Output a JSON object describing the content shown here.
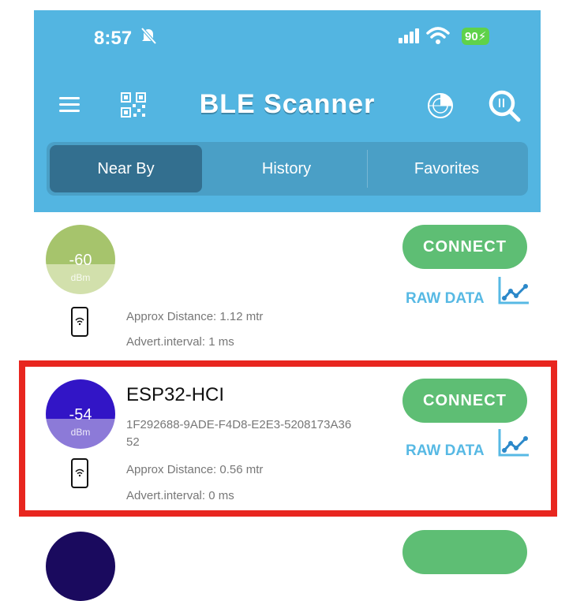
{
  "status_bar": {
    "time": "8:57",
    "battery": "90",
    "bell_icon": "bell-muted-icon",
    "signal_icon": "cellular-signal-icon",
    "wifi_icon": "wifi-icon"
  },
  "header": {
    "title": "BLE Scanner",
    "menu_icon": "hamburger-icon",
    "qr_icon": "qr-code-icon",
    "radar_icon": "radar-icon",
    "search_icon": "search-icon",
    "background_color": "#53b5e1"
  },
  "tabs": [
    {
      "label": "Near By",
      "active": true
    },
    {
      "label": "History",
      "active": false
    },
    {
      "label": "Favorites",
      "active": false
    }
  ],
  "devices": [
    {
      "rssi": "-60",
      "unit": "dBm",
      "name": "",
      "uuid": "",
      "distance": "Approx Distance: 1.12 mtr",
      "interval": "Advert.interval: 1 ms",
      "connect_label": "CONNECT",
      "raw_label": "RAW DATA",
      "colors": {
        "top": "#a6c46c",
        "bottom": "#d2e0ac"
      }
    },
    {
      "rssi": "-54",
      "unit": "dBm",
      "name": "ESP32-HCI",
      "uuid": "1F292688-9ADE-F4D8-E2E3-5208173A3652",
      "uuid_line1": "1F292688-9ADE-F4D8-E2E3-5208173A36",
      "uuid_line2": "52",
      "distance": "Approx Distance: 0.56 mtr",
      "interval": "Advert.interval: 0 ms",
      "connect_label": "CONNECT",
      "raw_label": "RAW DATA",
      "highlighted": true,
      "colors": {
        "top": "#3215c6",
        "bottom": "#8c7ad8"
      }
    }
  ],
  "accent_colors": {
    "connect": "#5ebe74",
    "raw_data": "#57b9e4",
    "highlight": "#e8261f"
  }
}
